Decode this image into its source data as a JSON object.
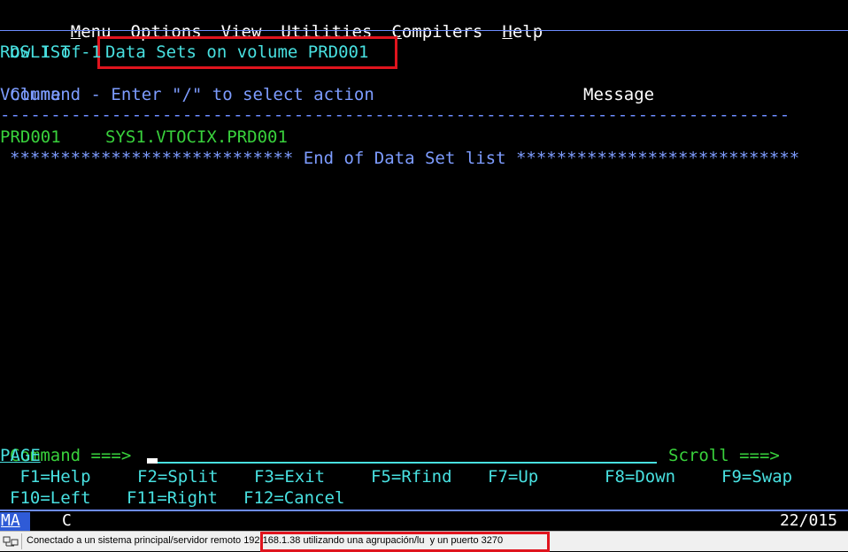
{
  "menu": {
    "items": [
      "Menu",
      "Options",
      "View",
      "Utilities",
      "Compilers",
      "Help"
    ]
  },
  "header": {
    "panel_id": "DSLIST -",
    "title": "Data Sets on volume PRD001",
    "row_info": "Row 1 of 1"
  },
  "columns": {
    "command": "Command - Enter \"/\" to select action",
    "message": "Message",
    "volume": "Volume"
  },
  "separator": "------------------------------------------------------------------------------",
  "rows": [
    {
      "dataset": "SYS1.VTOCIX.PRD001",
      "message": "",
      "volume": "PRD001"
    }
  ],
  "end_marker": "**************************** End of Data Set list ****************************",
  "command_line": {
    "label": "Command ===>",
    "value": "",
    "scroll_label": "Scroll ===>",
    "scroll_value": "PAGE"
  },
  "function_keys": {
    "row1": [
      " F1=Help",
      "F2=Split",
      "F3=Exit",
      "F5=Rfind",
      "F7=Up",
      "F8=Down",
      "F9=Swap"
    ],
    "row2": [
      "F10=Left",
      "F11=Right",
      "F12=Cancel"
    ]
  },
  "oia": {
    "indicator": "MA",
    "mode": "C",
    "cursor_position": "22/015"
  },
  "statusbar": {
    "text_prefix": "Conectado a un sistema principal/servidor remoto ",
    "text_highlight": "192.168.1.38 utilizando una agrupación/lu  y un puerto 3270"
  },
  "colors": {
    "background": "#000000",
    "menu_text": "#ffffff",
    "field_text": "#48e0e0",
    "label_text": "#7d9cff",
    "prompt_text": "#39d13c",
    "highlight_box": "#e0141e"
  }
}
